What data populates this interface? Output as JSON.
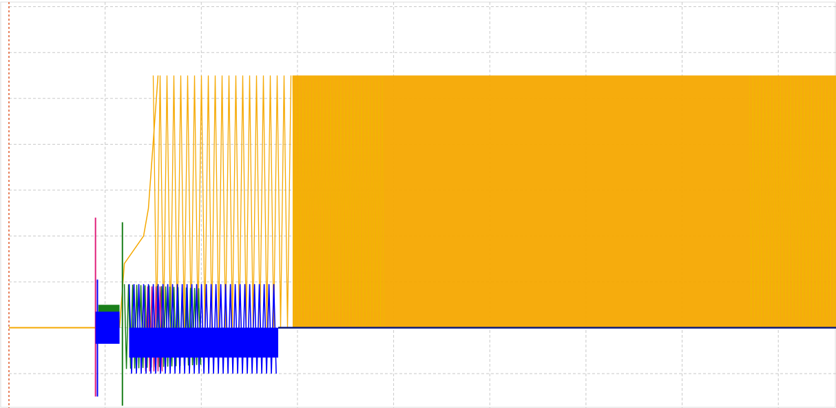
{
  "chart_data": {
    "type": "line",
    "title": "",
    "xlabel": "",
    "ylabel": "",
    "grid": true,
    "legend": "none",
    "xlim": [
      0,
      8.6
    ],
    "ylim": [
      -1.75,
      7.1
    ],
    "x_gridlines": [
      1,
      2,
      3,
      4,
      5,
      6,
      7,
      8
    ],
    "y_gridlines": [
      -1,
      0,
      1,
      2,
      3,
      4,
      5,
      6,
      7
    ],
    "series": [
      {
        "color": "#f5a800",
        "kind": "envelope",
        "description_points": [
          {
            "x": 0.0,
            "y": 0.0
          },
          {
            "x": 1.15,
            "y": 0.0
          },
          {
            "x": 1.2,
            "y": 1.4
          },
          {
            "x": 1.4,
            "y": 2.0
          },
          {
            "x": 1.45,
            "y": 2.6
          },
          {
            "x": 1.55,
            "y": 5.5
          },
          {
            "x": 8.6,
            "y": 5.5
          }
        ],
        "envelope": {
          "x": [
            1.45,
            8.6
          ],
          "min": 0.0,
          "max": 5.5
        }
      },
      {
        "color": "#1a7f1a",
        "kind": "envelope",
        "envelope": {
          "x": [
            0.93,
            2.0
          ],
          "min": -0.9,
          "max": 0.95
        }
      },
      {
        "color": "#e0207a",
        "kind": "spike",
        "points": [
          {
            "x": 0.9,
            "y": 2.4
          },
          {
            "x": 0.9,
            "y": -1.5
          }
        ]
      },
      {
        "color": "#0000ff",
        "kind": "envelope",
        "envelope": {
          "x": [
            0.9,
            2.8
          ],
          "min": -1.0,
          "max": 0.95
        }
      },
      {
        "color": "#0a1a7a",
        "kind": "baseline",
        "points": [
          {
            "x": 2.8,
            "y": 0.0
          },
          {
            "x": 8.6,
            "y": 0.0
          }
        ]
      }
    ]
  }
}
